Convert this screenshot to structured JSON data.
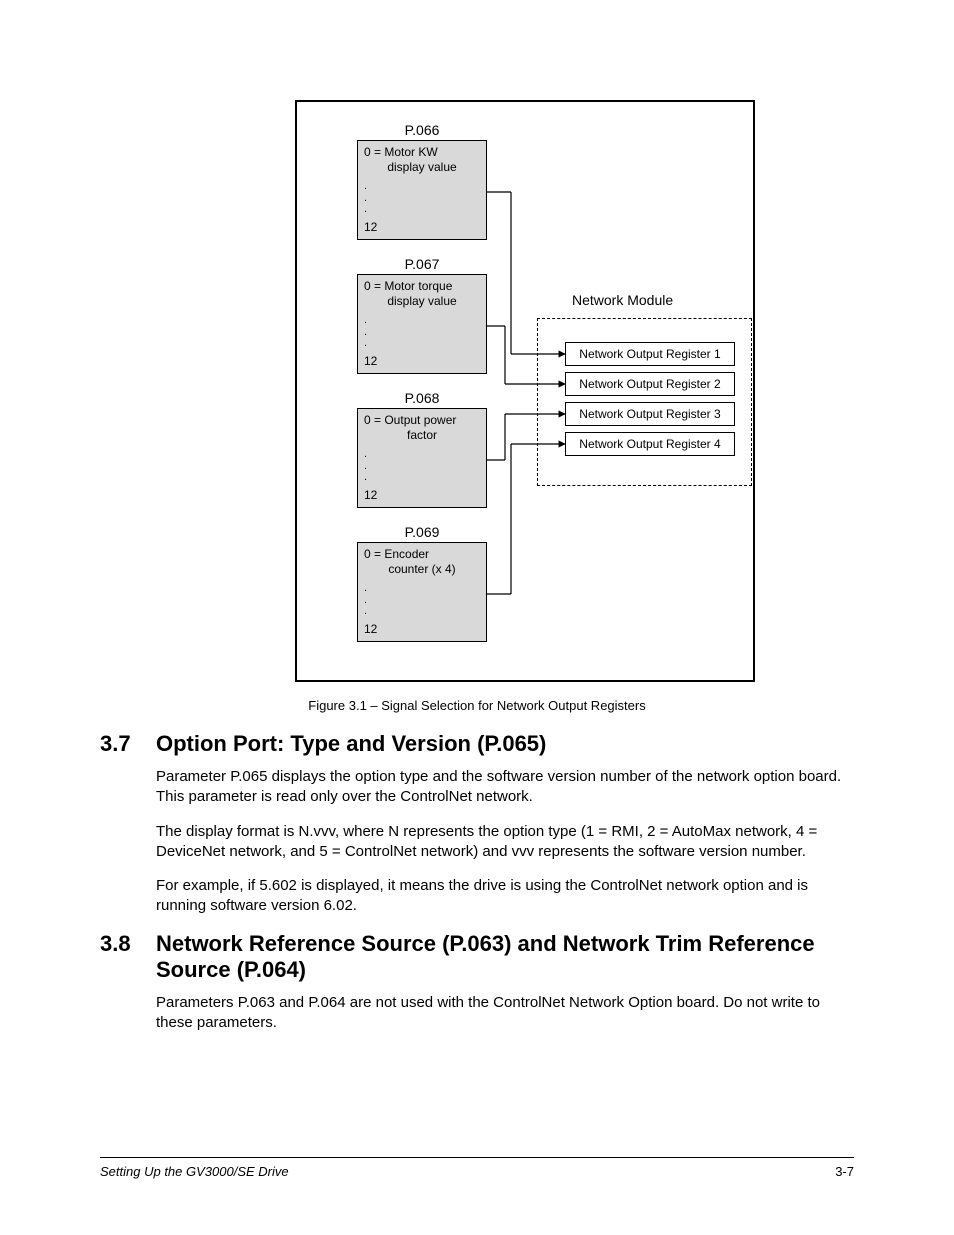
{
  "diagram": {
    "blocks": [
      {
        "title": "P.066",
        "line1": "0 = Motor KW",
        "line2": "display value",
        "end": "12"
      },
      {
        "title": "P.067",
        "line1": "0 = Motor torque",
        "line2": "display value",
        "end": "12"
      },
      {
        "title": "P.068",
        "line1": "0 = Output power",
        "line2": "factor",
        "end": "12"
      },
      {
        "title": "P.069",
        "line1": "0 = Encoder",
        "line2": "counter (x 4)",
        "end": "12"
      }
    ],
    "module_title": "Network Module",
    "registers": [
      "Network Output Register 1",
      "Network Output Register 2",
      "Network Output Register 3",
      "Network Output Register 4"
    ]
  },
  "caption": "Figure 3.1 – Signal Selection for Network Output Registers",
  "sec37": {
    "num": "3.7",
    "title": "Option Port: Type and Version (P.065)",
    "p1": "Parameter P.065 displays the option type and the software version number of the network option board. This parameter is read only over the ControlNet network.",
    "p2": "The display format is N.vvv, where N represents the option type (1 = RMI, 2 = AutoMax network, 4 = DeviceNet network, and 5 = ControlNet network) and vvv represents the software version number.",
    "p3": "For example, if 5.602 is displayed, it means the drive is using the ControlNet network option and is running software version 6.02."
  },
  "sec38": {
    "num": "3.8",
    "title": "Network Reference Source (P.063) and Network Trim Reference Source (P.064)",
    "p1": "Parameters P.063 and P.064 are not used with the ControlNet Network Option board. Do not write to these parameters."
  },
  "footer": {
    "left": "Setting Up the GV3000/SE Drive",
    "right": "3-7"
  }
}
